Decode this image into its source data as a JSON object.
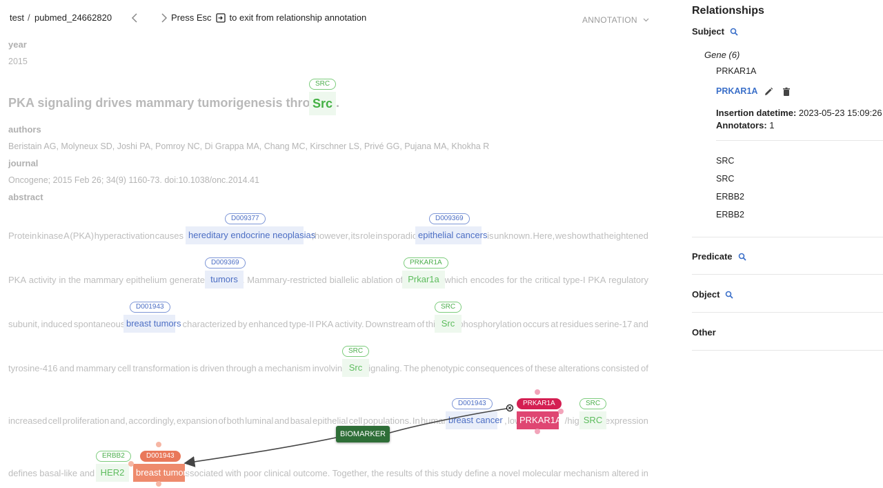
{
  "header": {
    "project": "test",
    "separator": "/",
    "document": "pubmed_24662820",
    "esc_msg_before": "Press Esc",
    "esc_msg_after": "to exit from relationship annotation",
    "mode": "ANNOTATION"
  },
  "doc": {
    "year_label": "year",
    "year_value": "2015",
    "title_text": "PKA signaling drives mammary tumorigenesis through",
    "title_entity": "Src",
    "title_entity_tag": "SRC",
    "title_period": ".",
    "authors_label": "authors",
    "authors_value": "Beristain AG, Molyneux SD, Joshi PA, Pomroy NC, Di Grappa MA, Chang MC, Kirschner LS, Privé GG, Pujana MA, Khokha R",
    "journal_label": "journal",
    "journal_value": "Oncogene; 2015 Feb 26; 34(9) 1160-73. doi:10.1038/onc.2014.41",
    "abstract_label": "abstract",
    "lines": [
      {
        "segments": [
          "Protein",
          "kinase",
          "A",
          "(PKA)",
          "hyperactivation",
          "causes",
          "hereditary endocrine neoplasias",
          ";",
          "however,",
          "its",
          "role",
          "in",
          "sporadic",
          "epithelial cancers",
          "is",
          "unknown.",
          "Here,",
          "we",
          "show",
          "that",
          "heightened"
        ]
      },
      {
        "segments": [
          "PKA",
          "activity",
          "in",
          "the",
          "mammary",
          "epithelium",
          "generates",
          "tumors",
          ".",
          "Mammary-restricted",
          "biallelic",
          "ablation",
          "of",
          "Prkar1a",
          ",",
          "which",
          "encodes",
          "for",
          "the",
          "critical",
          "type-I",
          "PKA",
          "regulatory"
        ]
      },
      {
        "segments": [
          "subunit,",
          "induced",
          "spontaneous",
          "breast tumors",
          "characterized",
          "by",
          "enhanced",
          "type-II",
          "PKA",
          "activity.",
          "Downstream",
          "of",
          "this,",
          "Src",
          "phosphorylation",
          "occurs",
          "at",
          "residues",
          "serine-17",
          "and"
        ]
      },
      {
        "segments": [
          "tyrosine-416",
          "and",
          "mammary",
          "cell",
          "transformation",
          "is",
          "driven",
          "through",
          "a",
          "mechanism",
          "involving",
          "Src",
          "signaling.",
          "The",
          "phenotypic",
          "consequences",
          "of",
          "these",
          "alterations",
          "consisted",
          "of"
        ]
      },
      {
        "segments": [
          "increased",
          "cell",
          "proliferation",
          "and,",
          "accordingly,",
          "expansion",
          "of",
          "both",
          "luminal",
          "and",
          "basal",
          "epithelial",
          "cell",
          "populations.",
          "In",
          "human",
          "breast cancer",
          ",",
          "low",
          "PRKAR1A",
          "/high",
          "SRC",
          "expression"
        ]
      },
      {
        "segments": [
          "defines",
          "basal-like",
          "and",
          "HER2",
          "breast tumors",
          "associated",
          "with",
          "poor",
          "clinical",
          "outcome.",
          "Together,",
          "the",
          "results",
          "of",
          "this",
          "study",
          "define",
          "a",
          "novel",
          "molecular",
          "mechanism",
          "altered",
          "in"
        ]
      }
    ],
    "entities": {
      "e1": {
        "text": "hereditary endocrine neoplasias",
        "tag": "D009377"
      },
      "e2": {
        "text": "epithelial cancers",
        "tag": "D009369"
      },
      "e3": {
        "text": "tumors",
        "tag": "D009369"
      },
      "e4": {
        "text": "Prkar1a",
        "tag": "PRKAR1A"
      },
      "e5": {
        "text": "breast tumors",
        "tag": "D001943"
      },
      "e6": {
        "text": "Src",
        "tag": "SRC"
      },
      "e7": {
        "text": "Src",
        "tag": "SRC"
      },
      "e8": {
        "text": "breast cancer",
        "tag": "D001943"
      },
      "e9": {
        "text": "PRKAR1A",
        "tag": "PRKAR1A"
      },
      "e10": {
        "text": "SRC",
        "tag": "SRC"
      },
      "e11": {
        "text": "HER2",
        "tag": "ERBB2"
      },
      "e12": {
        "text": "breast tumors",
        "tag": "D001943"
      }
    },
    "relation_label": "BIOMARKER"
  },
  "sidebar": {
    "title": "Relationships",
    "subject": "Subject",
    "gene_group": "Gene (6)",
    "items": [
      "PRKAR1A",
      "PRKAR1A",
      "SRC",
      "SRC",
      "ERBB2",
      "ERBB2"
    ],
    "insertion_label": "Insertion datetime:",
    "insertion_value": "2023-05-23 15:09:26",
    "annotators_label": "Annotators:",
    "annotators_value": "1",
    "predicate": "Predicate",
    "object": "Object",
    "other": "Other"
  },
  "colors": {
    "disease": "#4c6ec4",
    "gene": "#5cbc5c",
    "subject": "#d41f52",
    "object": "#e9785a",
    "relation": "#2e6e37",
    "link": "#3a6fc9"
  }
}
